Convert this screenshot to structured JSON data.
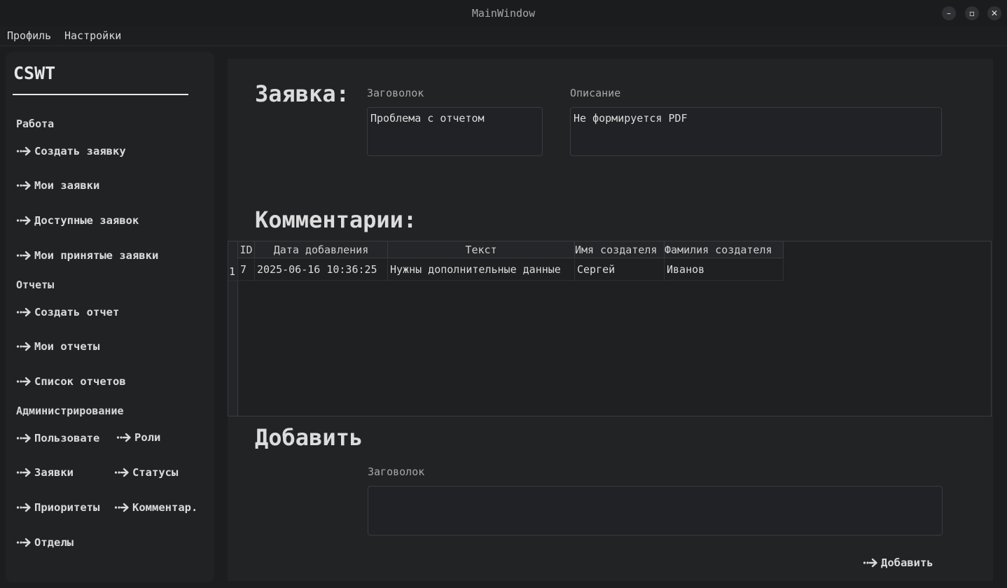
{
  "window": {
    "title": "MainWindow"
  },
  "menu": {
    "items": [
      "Профиль",
      "Настройки"
    ]
  },
  "sidebar": {
    "brand": "CSWT",
    "sections": {
      "work": "Работа",
      "reports": "Отчеты",
      "admin": "Администрирование"
    },
    "work_items": [
      "Создать заявку",
      "Мои заявки",
      "Доступные заявок",
      "Мои принятые заявки"
    ],
    "report_items": [
      "Создать отчет",
      "Мои отчеты",
      "Список отчетов"
    ],
    "admin_items": [
      "Пользовате",
      "Роли",
      "Заявки",
      "Статусы",
      "Приоритеты",
      "Комментар.",
      "Отделы"
    ]
  },
  "request": {
    "heading": "Заявка:",
    "title_label": "Заговолок",
    "title_value": "Проблема с отчетом",
    "desc_label": "Описание",
    "desc_value": "Не формируется PDF"
  },
  "comments": {
    "heading": "Комментарии:",
    "columns": [
      "ID",
      "Дата добавления",
      "Текст",
      "Имя создателя",
      "Фамилия создателя"
    ],
    "rows": [
      {
        "row_num": "1",
        "cells": [
          "7",
          "2025-06-16 10:36:25",
          "Нужны дополнительные данные",
          "Сергей",
          "Иванов"
        ]
      }
    ]
  },
  "add": {
    "heading": "Добавить",
    "label": "Заговолок",
    "value": "",
    "button": "Добавить"
  },
  "icons": {
    "arrow": "dotted-arrow-icon",
    "minimize": "minimize-icon",
    "maximize": "maximize-icon",
    "close": "close-icon"
  }
}
